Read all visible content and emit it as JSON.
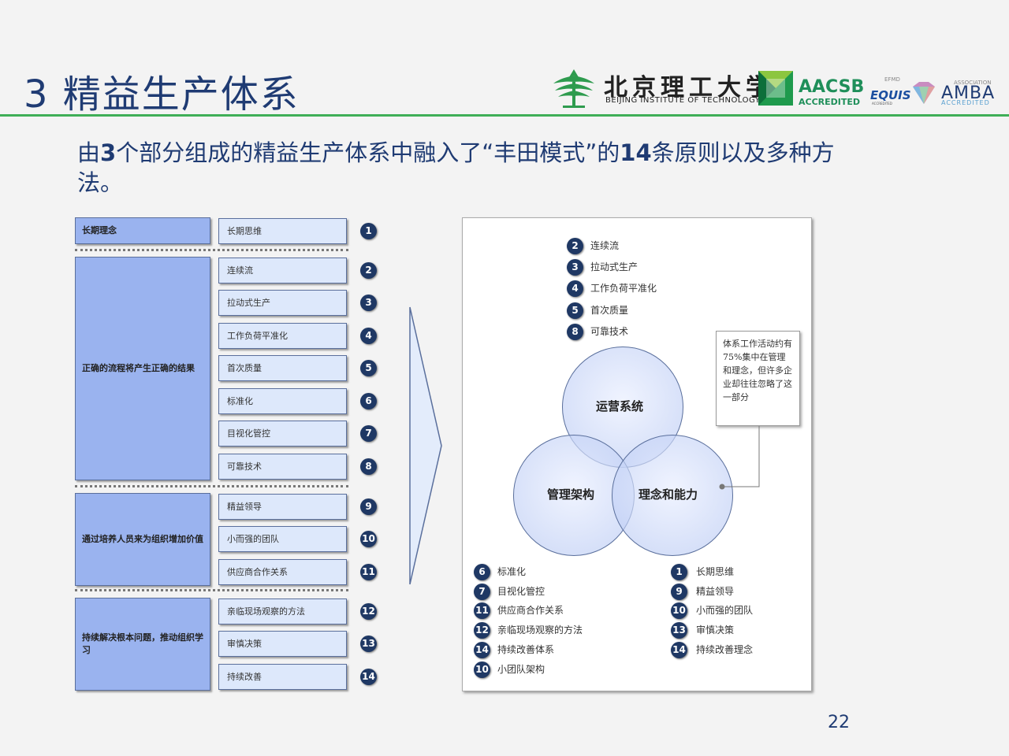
{
  "slide": {
    "title": "3 精益生产体系",
    "subtitle_parts": [
      "由",
      "3",
      "个部分组成的精益生产体系中融入了“丰田模式”的",
      "14",
      "条原则以及多种方法。"
    ],
    "page_number": "22"
  },
  "logos": {
    "bit_cn": "北京理工大学",
    "bit_en": "BEIJING INSTITUTE OF TECHNOLOGY",
    "aacsb": "AACSB",
    "aacsb_sub": "ACCREDITED",
    "efmd": "EFMD",
    "equis": "EQUIS",
    "equis_sub": "ACCREDITED",
    "amba_assoc": "ASSOCIATION",
    "amba": "AMBA",
    "amba_sub": "ACCREDITED"
  },
  "matrix": {
    "categories": [
      "长期理念",
      "正确的流程将产生正确的结果",
      "通过培养人员来为组织增加价值",
      "持续解决根本问题，推动组织学习"
    ],
    "principles": [
      {
        "num": "1",
        "label": "长期思维"
      },
      {
        "num": "2",
        "label": "连续流"
      },
      {
        "num": "3",
        "label": "拉动式生产"
      },
      {
        "num": "4",
        "label": "工作负荷平准化"
      },
      {
        "num": "5",
        "label": "首次质量"
      },
      {
        "num": "6",
        "label": "标准化"
      },
      {
        "num": "7",
        "label": "目视化管控"
      },
      {
        "num": "8",
        "label": "可靠技术"
      },
      {
        "num": "9",
        "label": "精益领导"
      },
      {
        "num": "10",
        "label": "小而强的团队"
      },
      {
        "num": "11",
        "label": "供应商合作关系"
      },
      {
        "num": "12",
        "label": "亲临现场观察的方法"
      },
      {
        "num": "13",
        "label": "审慎决策"
      },
      {
        "num": "14",
        "label": "持续改善"
      }
    ]
  },
  "diagram": {
    "top_items": [
      {
        "num": "2",
        "label": "连续流"
      },
      {
        "num": "3",
        "label": "拉动式生产"
      },
      {
        "num": "4",
        "label": "工作负荷平准化"
      },
      {
        "num": "5",
        "label": "首次质量"
      },
      {
        "num": "8",
        "label": "可靠技术"
      }
    ],
    "circles": {
      "top": "运营系统",
      "left": "管理架构",
      "right": "理念和能力"
    },
    "note": "体系工作活动约有75%集中在管理和理念，但许多企业却往往忽略了这一部分",
    "bottom_left_items": [
      {
        "num": "6",
        "label": "标准化"
      },
      {
        "num": "7",
        "label": "目视化管控"
      },
      {
        "num": "11",
        "label": "供应商合作关系"
      },
      {
        "num": "12",
        "label": "亲临现场观察的方法"
      },
      {
        "num": "14",
        "label": "持续改善体系"
      },
      {
        "num": "10",
        "label": "小团队架构"
      }
    ],
    "bottom_right_items": [
      {
        "num": "1",
        "label": "长期思维"
      },
      {
        "num": "9",
        "label": "精益领导"
      },
      {
        "num": "10",
        "label": "小而强的团队"
      },
      {
        "num": "13",
        "label": "审慎决策"
      },
      {
        "num": "14",
        "label": "持续改善理念"
      }
    ]
  },
  "colors": {
    "title": "#1f3b73",
    "rule": "#3fae57",
    "category_fill": "#9ab3ef",
    "principle_fill": "#dde8fb",
    "number_badge": "#1f3864"
  }
}
